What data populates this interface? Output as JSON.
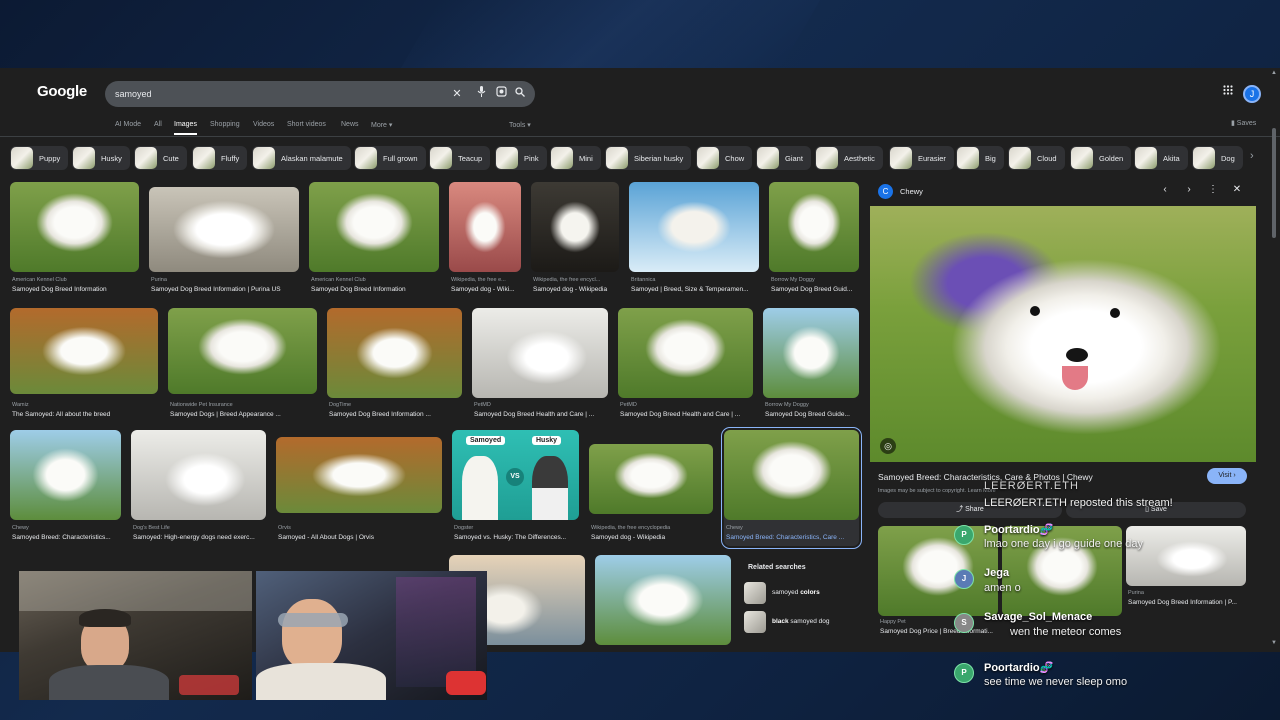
{
  "header": {
    "logo": "Google",
    "search_value": "samoyed",
    "tabs": [
      "AI Mode",
      "All",
      "Images",
      "Shopping",
      "Videos",
      "Short videos",
      "News",
      "More ▾"
    ],
    "active_tab": "Images",
    "tools_label": "Tools ▾",
    "saves_label": "Saves",
    "avatar_letter": "J"
  },
  "chips": [
    "Puppy",
    "Husky",
    "Cute",
    "Fluffy",
    "Alaskan malamute",
    "Full grown",
    "Teacup",
    "Pink",
    "Mini",
    "Siberian husky",
    "Chow",
    "Giant",
    "Aesthetic",
    "Eurasier",
    "Big",
    "Cloud",
    "Golden",
    "Akita",
    "Dog"
  ],
  "results": [
    {
      "source": "American Kennel Club",
      "caption": "Samoyed Dog Breed Information"
    },
    {
      "source": "Purina",
      "caption": "Samoyed Dog Breed Information | Purina US"
    },
    {
      "source": "American Kennel Club",
      "caption": "Samoyed Dog Breed Information"
    },
    {
      "source": "Wikipedia, the free e...",
      "caption": "Samoyed dog - Wiki..."
    },
    {
      "source": "Wikipedia, the free encycl...",
      "caption": "Samoyed dog - Wikipedia"
    },
    {
      "source": "Britannica",
      "caption": "Samoyed | Breed, Size & Temperamen..."
    },
    {
      "source": "Borrow My Doggy",
      "caption": "Samoyed Dog Breed Guid..."
    },
    {
      "source": "Wamiz",
      "caption": "The Samoyed: All about the breed"
    },
    {
      "source": "Nationwide Pet Insurance",
      "caption": "Samoyed Dogs | Breed Appearance ..."
    },
    {
      "source": "DogTime",
      "caption": "Samoyed Dog Breed Information ..."
    },
    {
      "source": "PetMD",
      "caption": "Samoyed Dog Breed Health and Care | ..."
    },
    {
      "source": "PetMD",
      "caption": "Samoyed Dog Breed Health and Care | ..."
    },
    {
      "source": "Borrow My Doggy",
      "caption": "Samoyed Dog Breed Guide..."
    },
    {
      "source": "Chewy",
      "caption": "Samoyed Breed: Characteristics..."
    },
    {
      "source": "Dog's Best Life",
      "caption": "Samoyed: High-energy dogs need exerc..."
    },
    {
      "source": "Orvis",
      "caption": "Samoyed - All About Dogs | Orvis"
    },
    {
      "source": "Dogster",
      "caption": "Samoyed vs. Husky: The Differences..."
    },
    {
      "source": "Wikipedia, the free encyclopedia",
      "caption": "Samoyed dog - Wikipedia"
    },
    {
      "source": "Chewy",
      "caption": "Samoyed Breed: Characteristics, Care ..."
    }
  ],
  "comparison_tile": {
    "left": "Samoyed",
    "vs": "VS",
    "right": "Husky"
  },
  "related": {
    "heading": "Related searches",
    "items": [
      {
        "plain": "samoyed ",
        "bold": "colors",
        "bold_first": false
      },
      {
        "plain": " samoyed dog",
        "bold": "black",
        "bold_first": true
      }
    ]
  },
  "panel": {
    "source": "Chewy",
    "favicon": "C",
    "title": "Samoyed Breed: Characteristics, Care & Photos | Chewy",
    "visit_label": "Visit ›",
    "note": "Images may be subject to copyright.",
    "learn_more": "Learn More",
    "share_label": "Share",
    "save_label": "Save",
    "related_results": [
      {
        "source": "Happy Pet",
        "caption": "Samoyed Dog Price | Breed Informati..."
      },
      {
        "source": "Purina",
        "caption": "Samoyed Dog Breed Information | P..."
      }
    ]
  },
  "chat": [
    {
      "user": "LEERØERT.ETH",
      "text": "LEERØERT.ETH reposted this stream!",
      "type": "repost"
    },
    {
      "user": "Poortardio🧬",
      "text": "lmao one day i go guide one day",
      "type": "msg"
    },
    {
      "user": "Jega",
      "text": "amen o",
      "type": "msg"
    },
    {
      "user": "Savage_Sol_Menace",
      "text": "wen the meteor comes",
      "type": "msg"
    },
    {
      "user": "Poortardio🧬",
      "text": "see time we never sleep omo",
      "type": "msg"
    }
  ],
  "colors": {
    "page_bg": "#1f1f1f",
    "accent": "#8ab4f8",
    "stream_bg": "#10213d",
    "search_box": "#4d5156"
  }
}
